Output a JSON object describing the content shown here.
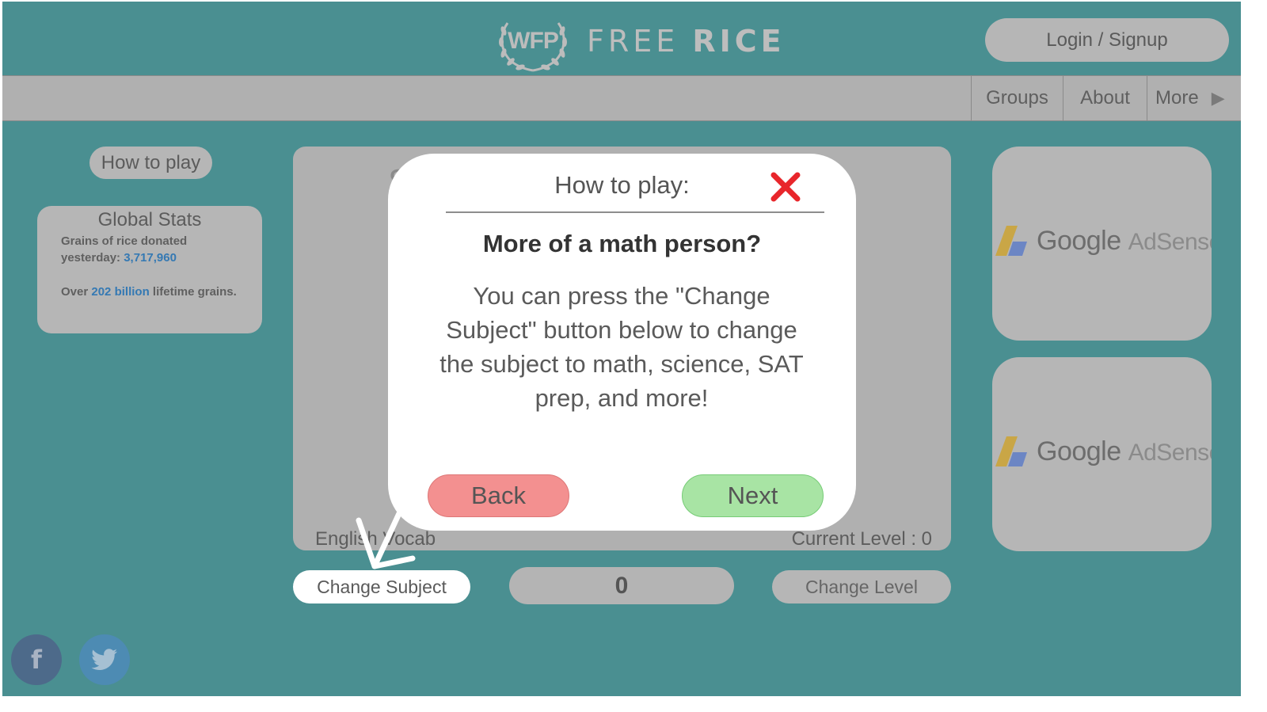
{
  "header": {
    "logo_emblem_text": "WFP",
    "brand_light": "FREE",
    "brand_bold": "RICE",
    "login_label": "Login / Signup"
  },
  "nav": {
    "items": [
      {
        "label": "Groups"
      },
      {
        "label": "About"
      },
      {
        "label": "More"
      }
    ]
  },
  "sidebar": {
    "how_to_play_label": "How to play",
    "stats": {
      "title": "Global Stats",
      "line1_prefix": "Grains of rice donated yesterday:",
      "line1_value": "3,717,960",
      "line2_prefix": "Over",
      "line2_value": "202 billion",
      "line2_suffix": "lifetime grains."
    }
  },
  "game": {
    "subject": "English Vocab",
    "level": "Current Level : 0",
    "change_subject_label": "Change Subject",
    "score": "0",
    "change_level_label": "Change Level"
  },
  "ads": [
    {
      "brand": "Google",
      "product": "AdSense"
    },
    {
      "brand": "Google",
      "product": "AdSense"
    }
  ],
  "modal": {
    "title": "How to play:",
    "heading": "More of a math person?",
    "body": "You can press the \"Change Subject\" button below to change the subject to math, science, SAT prep, and more!",
    "back_label": "Back",
    "next_label": "Next"
  },
  "social": {
    "facebook_glyph": "f"
  },
  "colors": {
    "background": "#4a8f91",
    "back_button": "#f39090",
    "next_button": "#a8e4a4",
    "close_x": "#e8262b",
    "link_blue": "#3579b3"
  }
}
